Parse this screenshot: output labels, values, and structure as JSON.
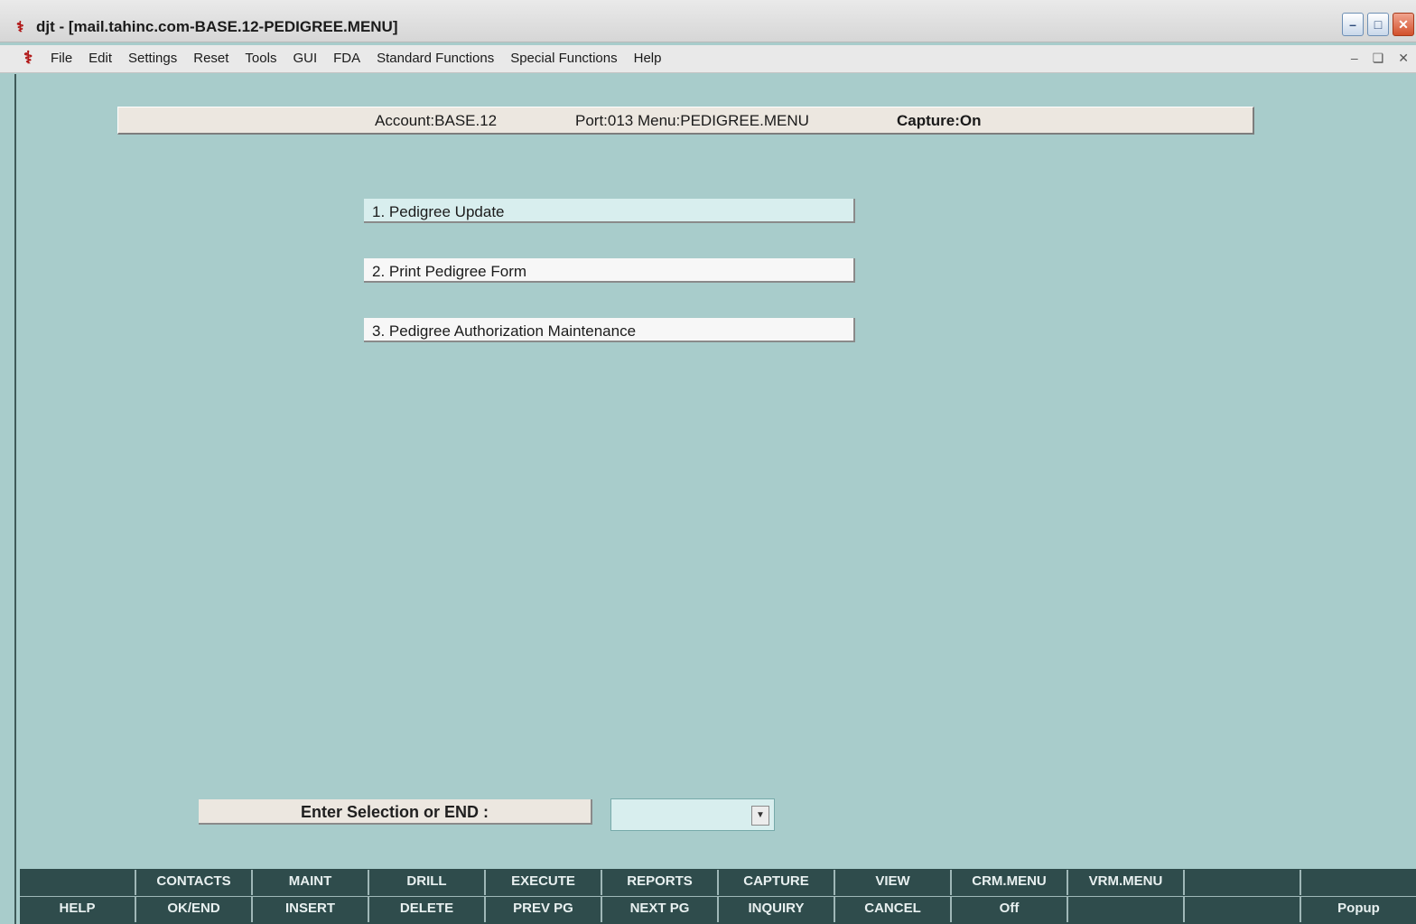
{
  "window": {
    "title": "djt - [mail.tahinc.com-BASE.12-PEDIGREE.MENU]",
    "app_icon": "caduceus-icon",
    "controls": [
      "minimize",
      "maximize",
      "close"
    ]
  },
  "menubar": {
    "items": [
      "File",
      "Edit",
      "Settings",
      "Reset",
      "Tools",
      "GUI",
      "FDA",
      "Standard Functions",
      "Special Functions",
      "Help"
    ]
  },
  "status": {
    "account": "Account:BASE.12",
    "port_menu": "Port:013 Menu:PEDIGREE.MENU",
    "capture": "Capture:On"
  },
  "options": [
    {
      "label": "1. Pedigree Update"
    },
    {
      "label": "2. Print Pedigree Form"
    },
    {
      "label": "3. Pedigree Authorization Maintenance"
    }
  ],
  "prompt": {
    "label": "Enter Selection or END :",
    "value": ""
  },
  "function_keys": {
    "top": [
      "",
      "CONTACTS",
      "MAINT",
      "DRILL",
      "EXECUTE",
      "REPORTS",
      "CAPTURE",
      "VIEW",
      "CRM.MENU",
      "VRM.MENU",
      "",
      ""
    ],
    "bottom": [
      "HELP",
      "OK/END",
      "INSERT",
      "DELETE",
      "PREV PG",
      "NEXT PG",
      "INQUIRY",
      "CANCEL",
      "Off",
      "",
      "",
      "Popup"
    ]
  },
  "colors": {
    "background": "#a8cccb",
    "fkey_bar": "#2f4c4c",
    "highlight": "#d8eeee"
  }
}
